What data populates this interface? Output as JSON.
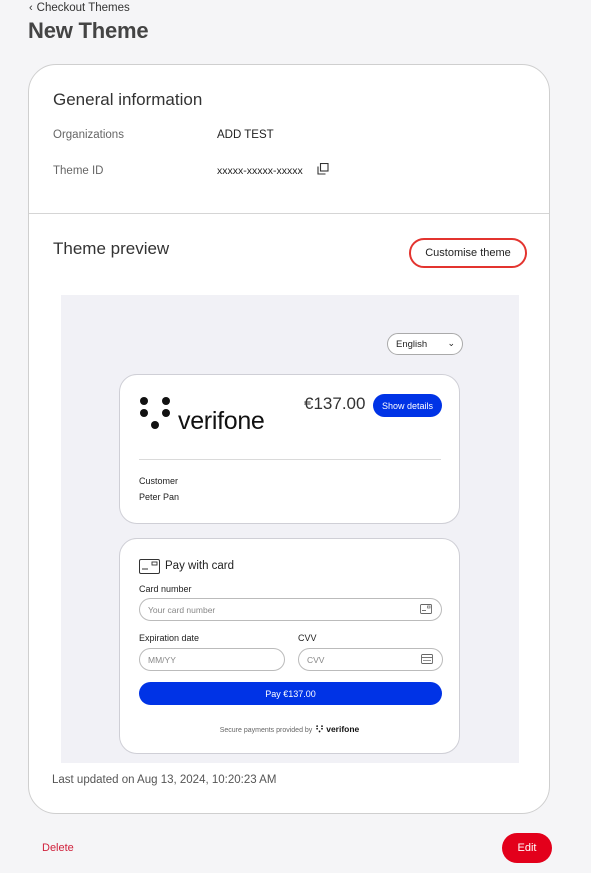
{
  "header": {
    "back_label": "Checkout Themes",
    "title": "New Theme"
  },
  "general": {
    "title": "General information",
    "organizations_label": "Organizations",
    "organizations_value": "ADD TEST",
    "theme_id_label": "Theme ID",
    "theme_id_value": "xxxxx-xxxxx-xxxxx"
  },
  "preview": {
    "title": "Theme preview",
    "customise_label": "Customise theme",
    "language": "English",
    "brand": "verifone",
    "amount": "€137.00",
    "show_details_label": "Show details",
    "customer_label": "Customer",
    "customer_name": "Peter Pan",
    "pay_with_card_title": "Pay with card",
    "card_number_label": "Card number",
    "card_number_placeholder": "Your card number",
    "expiration_label": "Expiration date",
    "expiration_placeholder": "MM/YY",
    "cvv_label": "CVV",
    "cvv_placeholder": "CVV",
    "pay_button_label": "Pay €137.00",
    "secure_text": "Secure payments provided by",
    "secure_brand": "verifone"
  },
  "footer": {
    "last_updated": "Last updated on Aug 13, 2024, 10:20:23 AM",
    "delete_label": "Delete",
    "edit_label": "Edit"
  },
  "colors": {
    "accent_red": "#e3001b",
    "preview_blue": "#0033e6",
    "outline_red": "#e3342f"
  },
  "icons": {
    "back": "chevron-left-icon",
    "copy": "copy-icon",
    "dropdown": "chevron-down-icon",
    "card": "credit-card-icon"
  }
}
